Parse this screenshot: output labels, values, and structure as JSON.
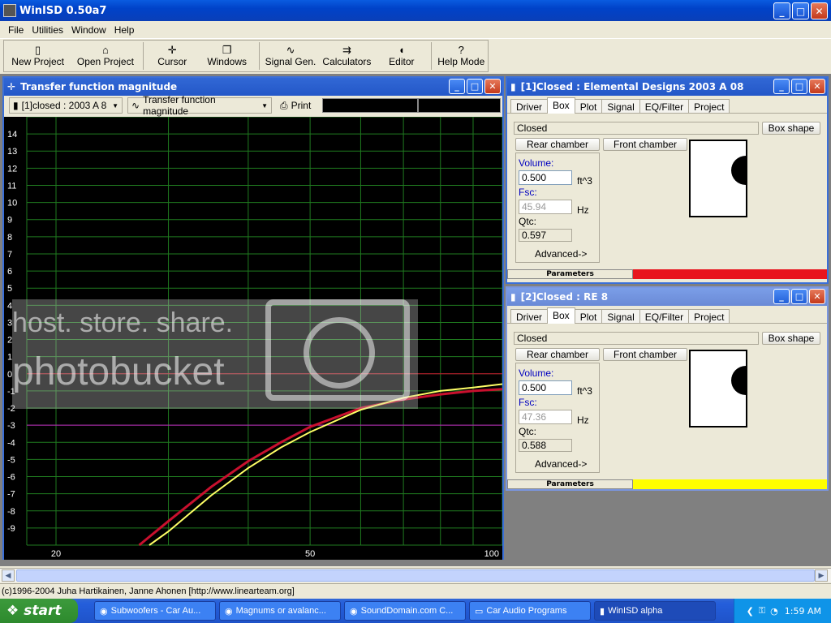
{
  "app": {
    "title": "WinISD 0.50a7"
  },
  "menu": [
    "File",
    "Utilities",
    "Window",
    "Help"
  ],
  "toolbar": {
    "new_project": "New Project",
    "open_project": "Open Project",
    "cursor": "Cursor",
    "windows": "Windows",
    "signal_gen": "Signal Gen.",
    "calculators": "Calculators",
    "editor": "Editor",
    "help_mode": "Help Mode"
  },
  "chart_window": {
    "title": "Transfer function magnitude",
    "project_combo": "[1]closed : 2003 A 8",
    "plot_combo": "Transfer function magnitude",
    "print_label": "Print"
  },
  "chart_data": {
    "type": "line",
    "xscale": "log",
    "xlim": [
      18,
      100
    ],
    "ylim": [
      -10,
      15
    ],
    "xticks": [
      "20",
      "50",
      "100"
    ],
    "yticks": [
      "14",
      "13",
      "12",
      "11",
      "10",
      "9",
      "8",
      "7",
      "6",
      "5",
      "4",
      "3",
      "2",
      "1",
      "0",
      "-1",
      "-2",
      "-3",
      "-4",
      "-5",
      "-6",
      "-7",
      "-8",
      "-9"
    ],
    "grid": true,
    "series": [
      {
        "color": "#c8102e",
        "x": [
          27,
          30,
          35,
          40,
          45,
          50,
          60,
          70,
          80,
          90,
          100
        ],
        "y": [
          -10,
          -8.6,
          -6.6,
          -5.1,
          -4.0,
          -3.1,
          -2.0,
          -1.5,
          -1.2,
          -1.0,
          -0.9
        ]
      },
      {
        "color": "#ffff66",
        "x": [
          28,
          30,
          35,
          40,
          45,
          50,
          60,
          70,
          80,
          90,
          100
        ],
        "y": [
          -10,
          -9.2,
          -7.1,
          -5.5,
          -4.3,
          -3.4,
          -2.1,
          -1.4,
          -1.0,
          -0.8,
          -0.6
        ]
      }
    ],
    "reference_lines": [
      {
        "y": 0,
        "color": "#c8102e"
      },
      {
        "y": -3,
        "color": "#c020c0"
      }
    ]
  },
  "watermark": {
    "line1": "host. store. share.",
    "line2": "photobucket"
  },
  "project1": {
    "title": "[1]Closed : Elemental Designs 2003 A 08",
    "tabs": [
      "Driver",
      "Box",
      "Plot",
      "Signal",
      "EQ/Filter",
      "Project"
    ],
    "box_type": "Closed",
    "box_shape": "Box shape",
    "rear_chamber": "Rear chamber",
    "front_chamber": "Front chamber",
    "volume_label": "Volume:",
    "volume": "0.500",
    "volume_unit": "ft^3",
    "fsc_label": "Fsc:",
    "fsc": "45.94",
    "fsc_unit": "Hz",
    "qtc_label": "Qtc:",
    "qtc": "0.597",
    "advanced": "Advanced->",
    "parameters": "Parameters",
    "color": "#e8141e"
  },
  "project2": {
    "title": "[2]Closed : RE 8",
    "tabs": [
      "Driver",
      "Box",
      "Plot",
      "Signal",
      "EQ/Filter",
      "Project"
    ],
    "box_type": "Closed",
    "box_shape": "Box shape",
    "rear_chamber": "Rear chamber",
    "front_chamber": "Front chamber",
    "volume_label": "Volume:",
    "volume": "0.500",
    "volume_unit": "ft^3",
    "fsc_label": "Fsc:",
    "fsc": "47.36",
    "fsc_unit": "Hz",
    "qtc_label": "Qtc:",
    "qtc": "0.588",
    "advanced": "Advanced->",
    "parameters": "Parameters",
    "color": "#ffff00"
  },
  "status": {
    "text": "(c)1996-2004 Juha Hartikainen, Janne Ahonen [http://www.linearteam.org]"
  },
  "taskbar": {
    "start": "start",
    "tasks": [
      "Subwoofers - Car Au...",
      "Magnums or avalanc...",
      "SoundDomain.com C...",
      "Car Audio Programs",
      "WinISD alpha"
    ],
    "clock": "1:59 AM"
  }
}
